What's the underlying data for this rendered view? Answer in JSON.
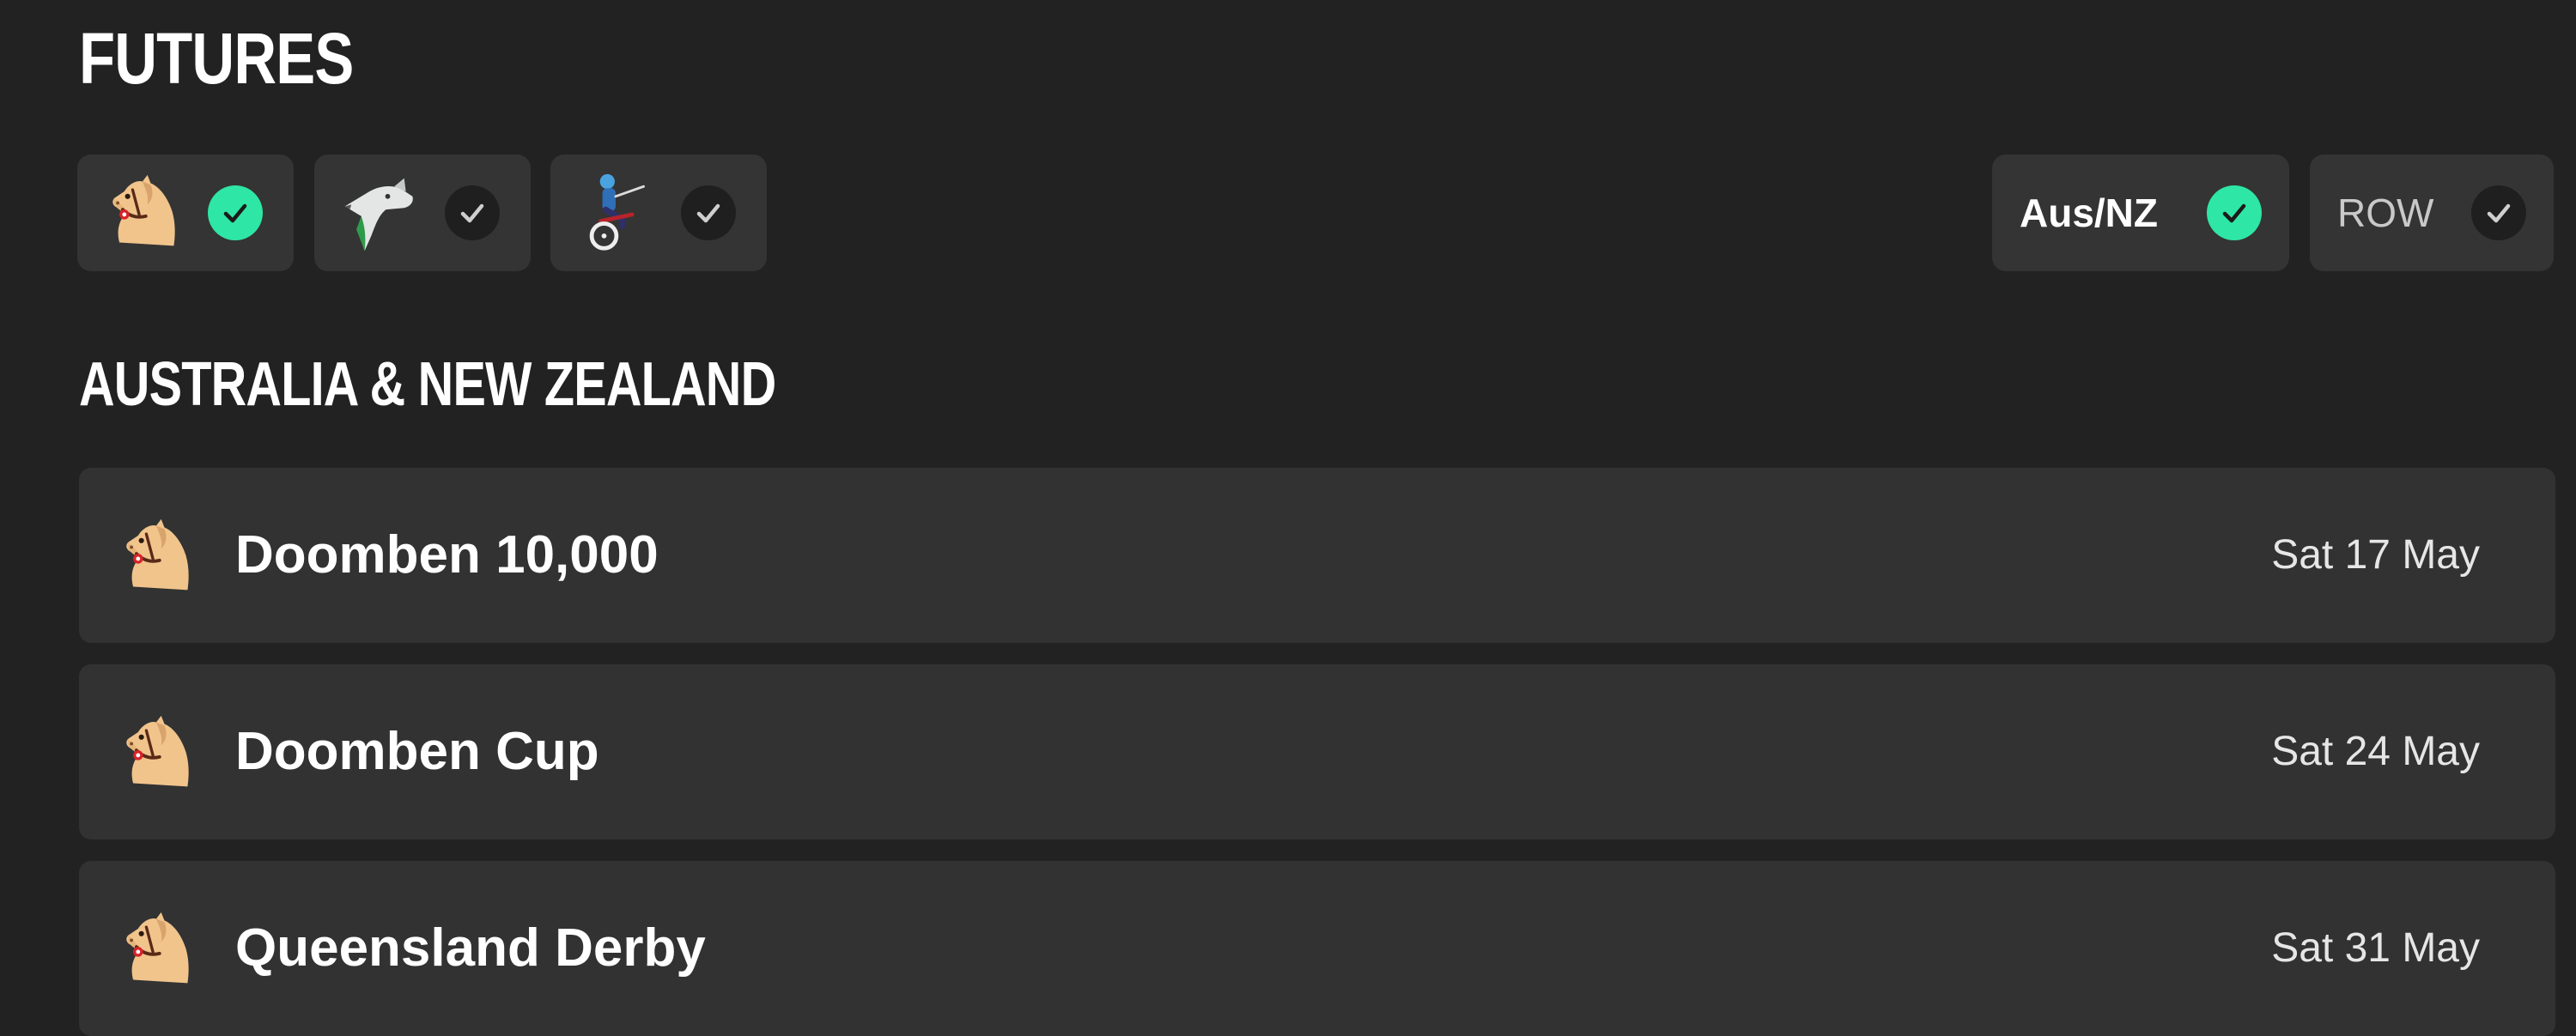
{
  "page": {
    "title": "FUTURES"
  },
  "filters": {
    "race_types": [
      {
        "name": "thoroughbred",
        "icon": "horse-head-icon",
        "selected": true
      },
      {
        "name": "greyhound",
        "icon": "greyhound-icon",
        "selected": false
      },
      {
        "name": "harness",
        "icon": "harness-racing-icon",
        "selected": false
      }
    ],
    "regions": [
      {
        "label": "Aus/NZ",
        "selected": true
      },
      {
        "label": "ROW",
        "selected": false
      }
    ]
  },
  "section": {
    "title": "AUSTRALIA & NEW ZEALAND"
  },
  "races": [
    {
      "name": "Doomben 10,000",
      "date": "Sat 17 May",
      "icon": "horse-head-icon"
    },
    {
      "name": "Doomben Cup",
      "date": "Sat 24 May",
      "icon": "horse-head-icon"
    },
    {
      "name": "Queensland Derby",
      "date": "Sat 31 May",
      "icon": "horse-head-icon"
    }
  ],
  "colors": {
    "background": "#222222",
    "chip": "#343434",
    "row": "#323232",
    "accent_check": "#2ee6a5",
    "check_off": "#1f1f1f",
    "horse_tan": "#f1c48c"
  }
}
